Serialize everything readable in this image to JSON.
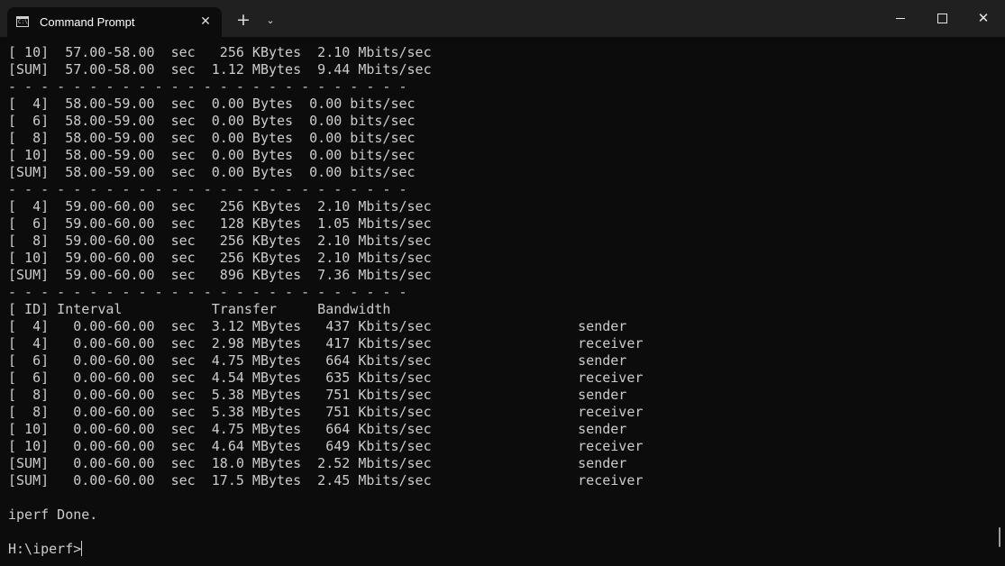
{
  "window": {
    "tab_title": "Command Prompt",
    "tab_icon": "cmd-icon",
    "new_tab_icon": "+",
    "dropdown_icon": "⌄",
    "min_icon": "minimize-icon",
    "max_icon": "maximize-icon",
    "close_icon": "✕",
    "tab_close": "✕"
  },
  "terminal": {
    "lines": [
      "[ 10]  57.00-58.00  sec   256 KBytes  2.10 Mbits/sec",
      "[SUM]  57.00-58.00  sec  1.12 MBytes  9.44 Mbits/sec",
      "- - - - - - - - - - - - - - - - - - - - - - - - -",
      "[  4]  58.00-59.00  sec  0.00 Bytes  0.00 bits/sec",
      "[  6]  58.00-59.00  sec  0.00 Bytes  0.00 bits/sec",
      "[  8]  58.00-59.00  sec  0.00 Bytes  0.00 bits/sec",
      "[ 10]  58.00-59.00  sec  0.00 Bytes  0.00 bits/sec",
      "[SUM]  58.00-59.00  sec  0.00 Bytes  0.00 bits/sec",
      "- - - - - - - - - - - - - - - - - - - - - - - - -",
      "[  4]  59.00-60.00  sec   256 KBytes  2.10 Mbits/sec",
      "[  6]  59.00-60.00  sec   128 KBytes  1.05 Mbits/sec",
      "[  8]  59.00-60.00  sec   256 KBytes  2.10 Mbits/sec",
      "[ 10]  59.00-60.00  sec   256 KBytes  2.10 Mbits/sec",
      "[SUM]  59.00-60.00  sec   896 KBytes  7.36 Mbits/sec",
      "- - - - - - - - - - - - - - - - - - - - - - - - -",
      "[ ID] Interval           Transfer     Bandwidth",
      "[  4]   0.00-60.00  sec  3.12 MBytes   437 Kbits/sec                  sender",
      "[  4]   0.00-60.00  sec  2.98 MBytes   417 Kbits/sec                  receiver",
      "[  6]   0.00-60.00  sec  4.75 MBytes   664 Kbits/sec                  sender",
      "[  6]   0.00-60.00  sec  4.54 MBytes   635 Kbits/sec                  receiver",
      "[  8]   0.00-60.00  sec  5.38 MBytes   751 Kbits/sec                  sender",
      "[  8]   0.00-60.00  sec  5.38 MBytes   751 Kbits/sec                  receiver",
      "[ 10]   0.00-60.00  sec  4.75 MBytes   664 Kbits/sec                  sender",
      "[ 10]   0.00-60.00  sec  4.64 MBytes   649 Kbits/sec                  receiver",
      "[SUM]   0.00-60.00  sec  18.0 MBytes  2.52 Mbits/sec                  sender",
      "[SUM]   0.00-60.00  sec  17.5 MBytes  2.45 Mbits/sec                  receiver",
      "",
      "iperf Done.",
      ""
    ],
    "prompt": "H:\\iperf>"
  }
}
